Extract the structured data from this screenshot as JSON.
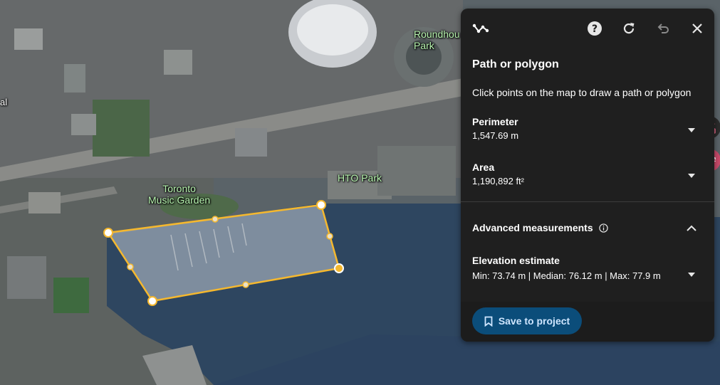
{
  "map": {
    "labels": {
      "toronto_music_garden": "Toronto\nMusic Garden",
      "hto_park": "HTO Park",
      "roundhouse_park": "Roundhou\nPark",
      "left_cut": "al"
    }
  },
  "panel": {
    "header_icons": [
      "path-tool-icon",
      "help-icon",
      "refresh-icon",
      "undo-icon",
      "close-icon"
    ],
    "title": "Path or polygon",
    "description": "Click points on the map to draw a path or polygon",
    "perimeter": {
      "label": "Perimeter",
      "value": "1,547.69 m"
    },
    "area": {
      "label": "Area",
      "value": "1,190,892 ft²"
    },
    "advanced": {
      "label": "Advanced measurements",
      "expanded": true
    },
    "elevation": {
      "label": "Elevation estimate",
      "value": "Min: 73.74 m | Median: 76.12 m | Max: 77.9 m"
    },
    "save_button": "Save to project"
  },
  "colors": {
    "panel_bg": "#1f1f1f",
    "polygon_stroke": "#f5b82e",
    "save_bg": "#0b4d7a",
    "save_text": "#cfe6ff",
    "map_label": "#b8f5b0"
  }
}
